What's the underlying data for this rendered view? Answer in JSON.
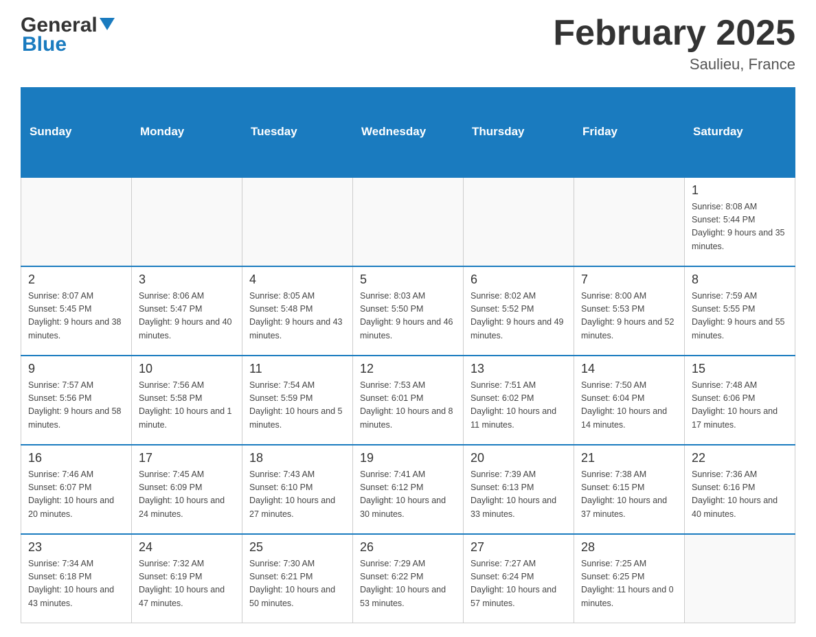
{
  "header": {
    "logo_part1": "General",
    "logo_part2": "Blue",
    "month_title": "February 2025",
    "location": "Saulieu, France"
  },
  "weekdays": [
    "Sunday",
    "Monday",
    "Tuesday",
    "Wednesday",
    "Thursday",
    "Friday",
    "Saturday"
  ],
  "weeks": [
    [
      {
        "day": "",
        "info": ""
      },
      {
        "day": "",
        "info": ""
      },
      {
        "day": "",
        "info": ""
      },
      {
        "day": "",
        "info": ""
      },
      {
        "day": "",
        "info": ""
      },
      {
        "day": "",
        "info": ""
      },
      {
        "day": "1",
        "info": "Sunrise: 8:08 AM\nSunset: 5:44 PM\nDaylight: 9 hours and 35 minutes."
      }
    ],
    [
      {
        "day": "2",
        "info": "Sunrise: 8:07 AM\nSunset: 5:45 PM\nDaylight: 9 hours and 38 minutes."
      },
      {
        "day": "3",
        "info": "Sunrise: 8:06 AM\nSunset: 5:47 PM\nDaylight: 9 hours and 40 minutes."
      },
      {
        "day": "4",
        "info": "Sunrise: 8:05 AM\nSunset: 5:48 PM\nDaylight: 9 hours and 43 minutes."
      },
      {
        "day": "5",
        "info": "Sunrise: 8:03 AM\nSunset: 5:50 PM\nDaylight: 9 hours and 46 minutes."
      },
      {
        "day": "6",
        "info": "Sunrise: 8:02 AM\nSunset: 5:52 PM\nDaylight: 9 hours and 49 minutes."
      },
      {
        "day": "7",
        "info": "Sunrise: 8:00 AM\nSunset: 5:53 PM\nDaylight: 9 hours and 52 minutes."
      },
      {
        "day": "8",
        "info": "Sunrise: 7:59 AM\nSunset: 5:55 PM\nDaylight: 9 hours and 55 minutes."
      }
    ],
    [
      {
        "day": "9",
        "info": "Sunrise: 7:57 AM\nSunset: 5:56 PM\nDaylight: 9 hours and 58 minutes."
      },
      {
        "day": "10",
        "info": "Sunrise: 7:56 AM\nSunset: 5:58 PM\nDaylight: 10 hours and 1 minute."
      },
      {
        "day": "11",
        "info": "Sunrise: 7:54 AM\nSunset: 5:59 PM\nDaylight: 10 hours and 5 minutes."
      },
      {
        "day": "12",
        "info": "Sunrise: 7:53 AM\nSunset: 6:01 PM\nDaylight: 10 hours and 8 minutes."
      },
      {
        "day": "13",
        "info": "Sunrise: 7:51 AM\nSunset: 6:02 PM\nDaylight: 10 hours and 11 minutes."
      },
      {
        "day": "14",
        "info": "Sunrise: 7:50 AM\nSunset: 6:04 PM\nDaylight: 10 hours and 14 minutes."
      },
      {
        "day": "15",
        "info": "Sunrise: 7:48 AM\nSunset: 6:06 PM\nDaylight: 10 hours and 17 minutes."
      }
    ],
    [
      {
        "day": "16",
        "info": "Sunrise: 7:46 AM\nSunset: 6:07 PM\nDaylight: 10 hours and 20 minutes."
      },
      {
        "day": "17",
        "info": "Sunrise: 7:45 AM\nSunset: 6:09 PM\nDaylight: 10 hours and 24 minutes."
      },
      {
        "day": "18",
        "info": "Sunrise: 7:43 AM\nSunset: 6:10 PM\nDaylight: 10 hours and 27 minutes."
      },
      {
        "day": "19",
        "info": "Sunrise: 7:41 AM\nSunset: 6:12 PM\nDaylight: 10 hours and 30 minutes."
      },
      {
        "day": "20",
        "info": "Sunrise: 7:39 AM\nSunset: 6:13 PM\nDaylight: 10 hours and 33 minutes."
      },
      {
        "day": "21",
        "info": "Sunrise: 7:38 AM\nSunset: 6:15 PM\nDaylight: 10 hours and 37 minutes."
      },
      {
        "day": "22",
        "info": "Sunrise: 7:36 AM\nSunset: 6:16 PM\nDaylight: 10 hours and 40 minutes."
      }
    ],
    [
      {
        "day": "23",
        "info": "Sunrise: 7:34 AM\nSunset: 6:18 PM\nDaylight: 10 hours and 43 minutes."
      },
      {
        "day": "24",
        "info": "Sunrise: 7:32 AM\nSunset: 6:19 PM\nDaylight: 10 hours and 47 minutes."
      },
      {
        "day": "25",
        "info": "Sunrise: 7:30 AM\nSunset: 6:21 PM\nDaylight: 10 hours and 50 minutes."
      },
      {
        "day": "26",
        "info": "Sunrise: 7:29 AM\nSunset: 6:22 PM\nDaylight: 10 hours and 53 minutes."
      },
      {
        "day": "27",
        "info": "Sunrise: 7:27 AM\nSunset: 6:24 PM\nDaylight: 10 hours and 57 minutes."
      },
      {
        "day": "28",
        "info": "Sunrise: 7:25 AM\nSunset: 6:25 PM\nDaylight: 11 hours and 0 minutes."
      },
      {
        "day": "",
        "info": ""
      }
    ]
  ]
}
